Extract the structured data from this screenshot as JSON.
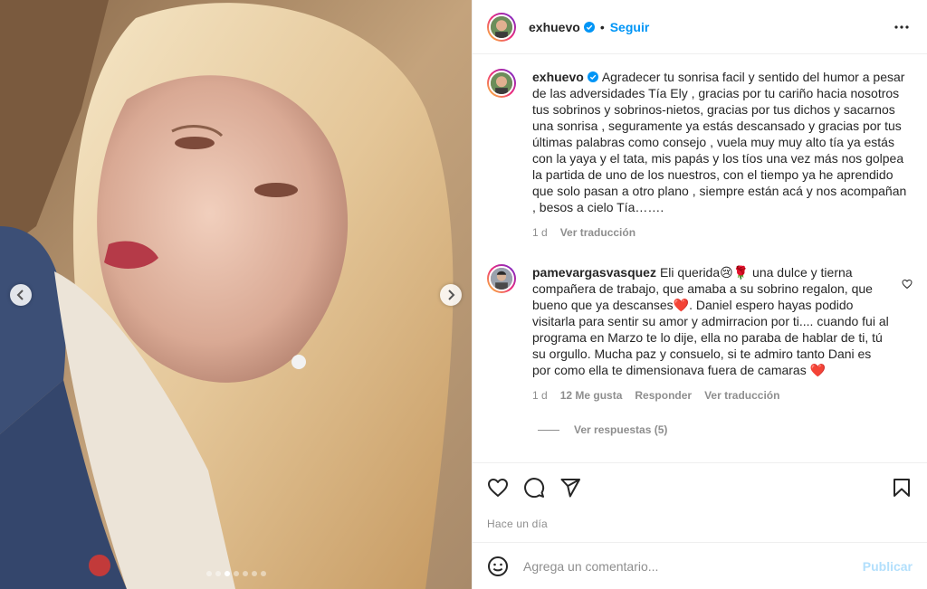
{
  "header": {
    "username": "exhuevo",
    "follow_label": "Seguir",
    "separator": "•"
  },
  "caption": {
    "username": "exhuevo",
    "text": "Agradecer tu sonrisa facil y sentido del humor a pesar de las adversidades Tía Ely , gracias por tu cariño hacia nosotros tus sobrinos y sobrinos-nietos, gracias por tus dichos y sacarnos una sonrisa , seguramente ya estás descansado y gracias por tus últimas palabras como consejo , vuela muy muy alto tía ya estás con la yaya y el tata, mis papás y los tíos una vez más nos golpea la partida de uno de los nuestros, con el tiempo ya he aprendido que solo pasan a otro plano , siempre están acá y nos acompañan , besos a cielo Tía…….",
    "age": "1 d",
    "translate_label": "Ver traducción"
  },
  "comment": {
    "username": "pamevargasvasquez",
    "text": "Eli querida😢🌹 una dulce y tierna compañera de trabajo, que amaba a su sobrino regalon, que bueno que ya descanses❤️. Daniel espero hayas podido visitarla para sentir su amor y admirracion por ti.... cuando fui al programa en Marzo te lo dije, ella no paraba de hablar de ti, tú su orgullo. Mucha paz y consuelo, si te admiro tanto Dani es por como ella te dimensionava fuera de camaras ❤️",
    "age": "1 d",
    "likes": "12 Me gusta",
    "reply_label": "Responder",
    "translate_label": "Ver traducción",
    "view_replies": "Ver respuestas (5)"
  },
  "footer": {
    "timestamp": "Hace un día",
    "comment_placeholder": "Agrega un comentario...",
    "publish_label": "Publicar"
  },
  "carousel": {
    "slide_count": 7,
    "active_index": 2
  },
  "colors": {
    "accent": "#0095f6",
    "muted": "#8e8e8e",
    "publish_disabled": "#b2dffc"
  }
}
